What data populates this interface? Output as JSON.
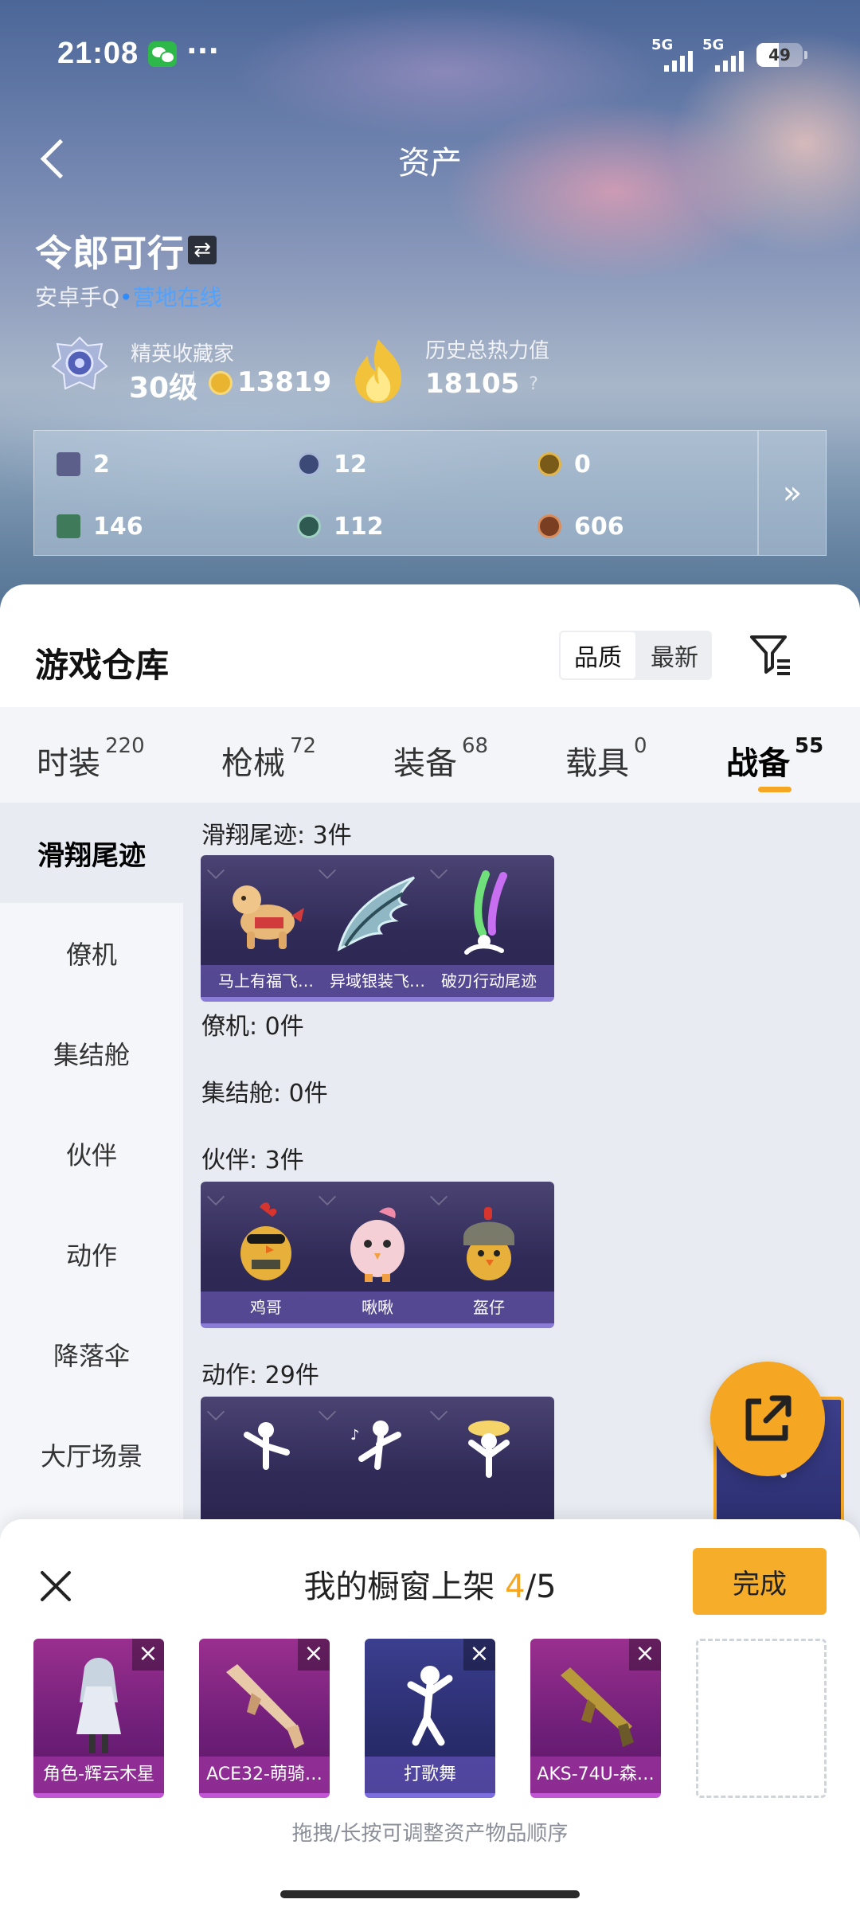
{
  "status_bar": {
    "time": "21:08",
    "network_1": "5G",
    "network_2": "5G",
    "battery": "49"
  },
  "header": {
    "title": "资产"
  },
  "profile": {
    "name": "令郎可行",
    "platform": "安卓手Q",
    "online_status": "营地在线",
    "rank_title": "精英收藏家",
    "level": "30级",
    "points": "13819",
    "heat_label": "历史总热力值",
    "heat_value": "18105",
    "help": "?"
  },
  "stats": [
    {
      "icon": "card-icon",
      "value": "2"
    },
    {
      "icon": "blue-coin-icon",
      "value": "12"
    },
    {
      "icon": "gold-coin-icon",
      "value": "0"
    },
    {
      "icon": "green-card-icon",
      "value": "146"
    },
    {
      "icon": "green-coin-icon",
      "value": "112"
    },
    {
      "icon": "bronze-coin-icon",
      "value": "606"
    }
  ],
  "stats_more": "»",
  "warehouse": {
    "title": "游戏仓库",
    "sort_options": [
      "品质",
      "最新"
    ],
    "sort_active": "品质"
  },
  "tabs": [
    {
      "label": "时装",
      "count": "220"
    },
    {
      "label": "枪械",
      "count": "72"
    },
    {
      "label": "装备",
      "count": "68"
    },
    {
      "label": "载具",
      "count": "0"
    },
    {
      "label": "战备",
      "count": "55"
    }
  ],
  "active_tab": "战备",
  "side_nav": [
    "滑翔尾迹",
    "僚机",
    "集结舱",
    "伙伴",
    "动作",
    "降落伞",
    "大厅场景"
  ],
  "side_nav_active": "滑翔尾迹",
  "groups": {
    "trail": {
      "label": "滑翔尾迹: 3件",
      "items": [
        "马上有福飞…",
        "异域银装飞…",
        "破刃行动尾迹"
      ]
    },
    "wingman": {
      "label": "僚机: 0件"
    },
    "pod": {
      "label": "集结舱: 0件"
    },
    "partner": {
      "label": "伙伴: 3件",
      "items": [
        "鸡哥",
        "啾啾",
        "盔仔"
      ]
    },
    "emote": {
      "label": "动作: 29件"
    }
  },
  "showcase": {
    "title": "我的橱窗上架",
    "current": "4",
    "separator": "/",
    "total": "5",
    "done_label": "完成",
    "slots": [
      "角色-辉云木星",
      "ACE32-萌骑…",
      "打歌舞",
      "AKS-74U-森…"
    ],
    "remove_symbol": "×",
    "hint": "拖拽/长按可调整资产物品顺序"
  },
  "colors": {
    "accent": "#f5a623",
    "online": "#4fa3ff"
  }
}
